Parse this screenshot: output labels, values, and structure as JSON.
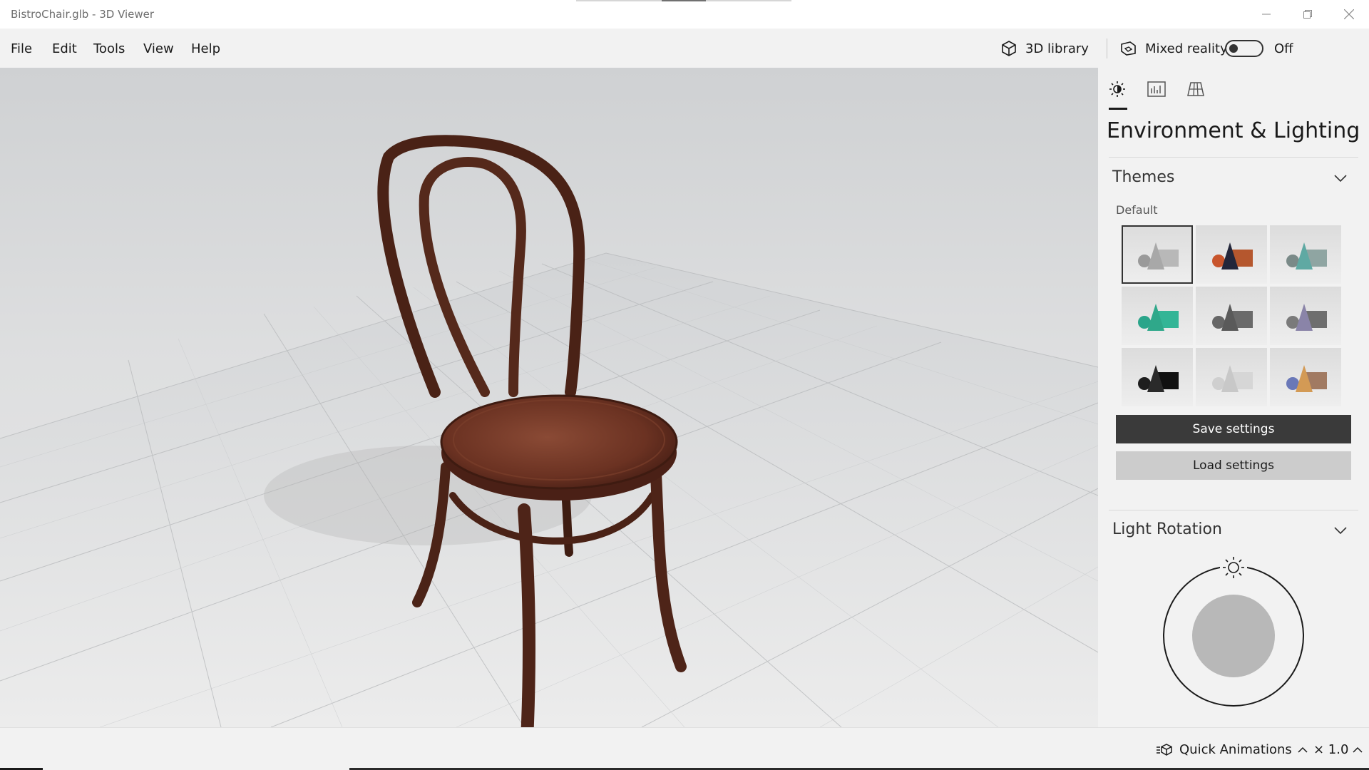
{
  "window": {
    "title": "BistroChair.glb - 3D Viewer"
  },
  "menu": {
    "items": [
      "File",
      "Edit",
      "Tools",
      "View",
      "Help"
    ]
  },
  "toolbar": {
    "library_label": "3D library",
    "mixed_reality_label": "Mixed reality",
    "toggle_state_label": "Off",
    "mixed_reality_on": false
  },
  "panel": {
    "tabs": [
      "sun-icon",
      "stats-icon",
      "grid-icon"
    ],
    "title": "Environment & Lighting",
    "themes": {
      "heading": "Themes",
      "subheading": "Default",
      "selected_index": 0,
      "swatches": [
        {
          "cone": "#a8a8a8",
          "sphere": "#9a9a9a",
          "box": "#b8b8b8"
        },
        {
          "cone": "#23263a",
          "sphere": "#c8552c",
          "box": "#b5572e"
        },
        {
          "cone": "#5fa9a3",
          "sphere": "#7a8a88",
          "box": "#8fa5a2"
        },
        {
          "cone": "#2fa88a",
          "sphere": "#2aa58a",
          "box": "#33b596"
        },
        {
          "cone": "#5a5a5a",
          "sphere": "#666666",
          "box": "#6a6a6a"
        },
        {
          "cone": "#8a84a8",
          "sphere": "#7a7a7a",
          "box": "#6e6e6e"
        },
        {
          "cone": "#2a2a2a",
          "sphere": "#1e1e1e",
          "box": "#111111"
        },
        {
          "cone": "#c8c8c8",
          "sphere": "#cfcfcf",
          "box": "#d6d6d6"
        },
        {
          "cone": "#d39a55",
          "sphere": "#6a78b8",
          "box": "#a17a62"
        }
      ],
      "save_label": "Save settings",
      "load_label": "Load settings"
    },
    "light_rotation": {
      "heading": "Light Rotation"
    }
  },
  "status": {
    "quick_animations_label": "Quick Animations",
    "speed_label": "× 1.0"
  },
  "colors": {
    "accent_dark": "#3a3a3a",
    "panel_bg": "#f2f2f2",
    "chair_wood": "#5a2b1c"
  }
}
